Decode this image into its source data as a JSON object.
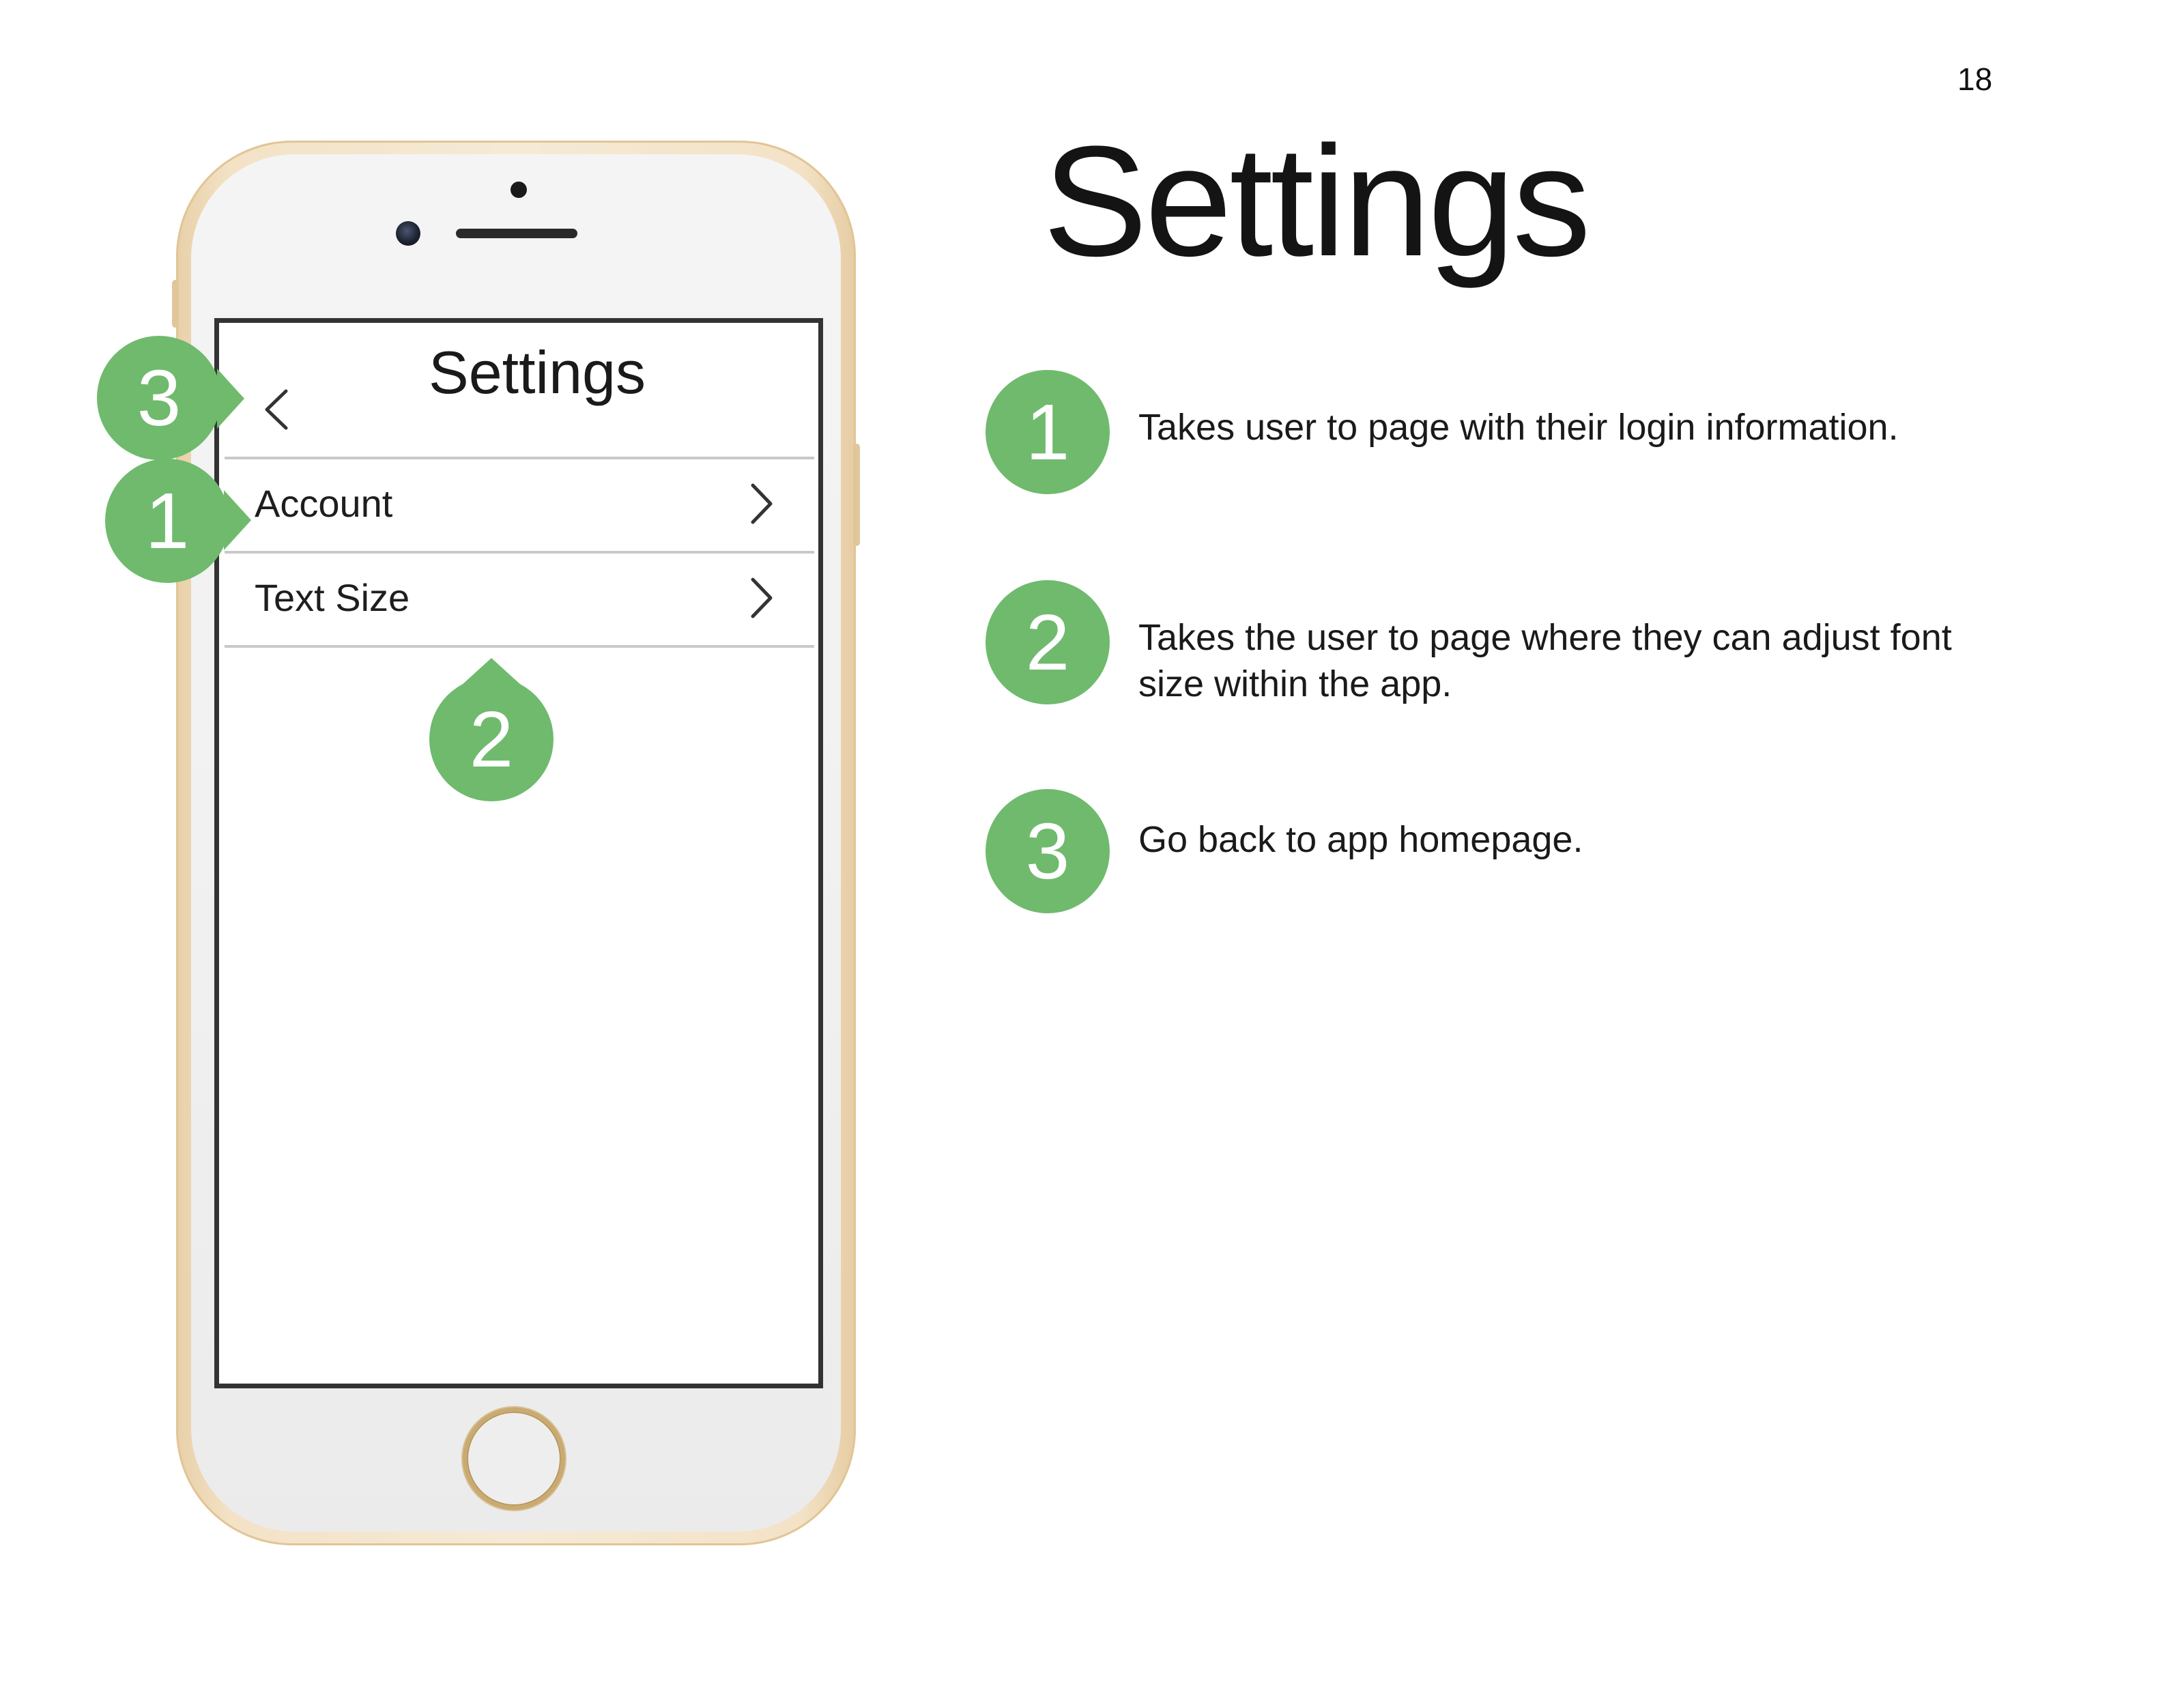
{
  "page": {
    "number": "18",
    "title": "Settings"
  },
  "phone": {
    "screen": {
      "header_title": "Settings",
      "back_icon": "chevron-left-icon",
      "rows": [
        {
          "label": "Account",
          "icon": "chevron-right-icon"
        },
        {
          "label": "Text Size",
          "icon": "chevron-right-icon"
        }
      ]
    }
  },
  "callouts": [
    {
      "number": "1",
      "text": "Takes user to page with their login information."
    },
    {
      "number": "2",
      "text": "Takes the user to page where they can adjust font size within the app."
    },
    {
      "number": "3",
      "text": "Go back to app homepage."
    }
  ],
  "colors": {
    "marker_green": "#6fba6d",
    "phone_gold": "#e8d0a8",
    "screen_border": "#333333"
  }
}
